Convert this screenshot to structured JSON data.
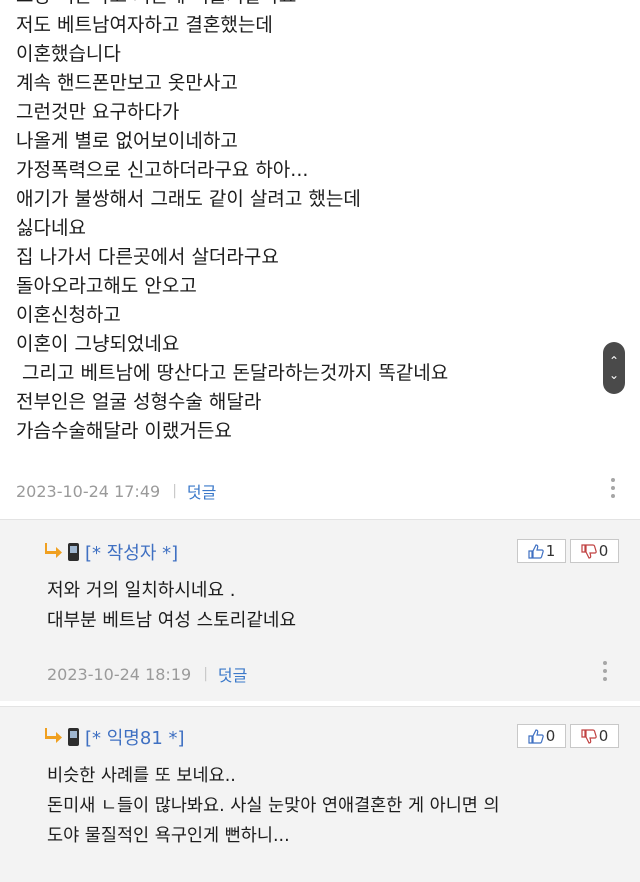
{
  "main_comment": {
    "lines": [
      "그냥 이혼하고 지근게 더를거같아요",
      "저도 베트남여자하고 결혼했는데",
      "이혼했습니다",
      "계속 핸드폰만보고 옷만사고",
      "그런것만 요구하다가",
      "나올게 별로 없어보이네하고",
      "가정폭력으로 신고하더라구요 하아...",
      "애기가 불쌍해서 그래도 같이 살려고 했는데",
      "싫다네요",
      "집 나가서 다른곳에서 살더라구요",
      "돌아오라고해도 안오고",
      "이혼신청하고",
      "이혼이 그냥되었네요",
      " 그리고 베트남에 땅산다고 돈달라하는것까지 똑같네요",
      "전부인은 얼굴 성형수술 해달라",
      "가슴수술해달라 이랬거든요"
    ],
    "timestamp": "2023-10-24 17:49",
    "reply_label": "덧글"
  },
  "replies": [
    {
      "author": "[* 작성자 *]",
      "lines": [
        "저와 거의 일치하시네요 .",
        "대부분 베트남 여성 스토리같네요"
      ],
      "upvotes": "1",
      "downvotes": "0",
      "timestamp": "2023-10-24 18:19",
      "reply_label": "덧글"
    },
    {
      "author": "[* 익명81 *]",
      "lines": [
        "비슷한 사례를 또 보네요..",
        "돈미새 ㄴ들이 많나봐요. 사실 눈맞아 연애결혼한 게 아니면 의",
        "도야 물질적인 욕구인게 뻔하니..."
      ],
      "upvotes": "0",
      "downvotes": "0"
    }
  ],
  "icons": {
    "reply_arrow": "reply-arrow-icon",
    "phone": "mobile-phone-icon",
    "thumbs_up": "thumbs-up-icon",
    "thumbs_down": "thumbs-down-icon",
    "more": "more-vertical-icon",
    "scroll": "scroll-up-down-icon"
  },
  "colors": {
    "author": "#3f70c2",
    "reply_link": "#3a78c9",
    "meta": "#9a9a9a",
    "reply_bg": "#f3f3f3",
    "reply_arrow": "#f0a020"
  }
}
